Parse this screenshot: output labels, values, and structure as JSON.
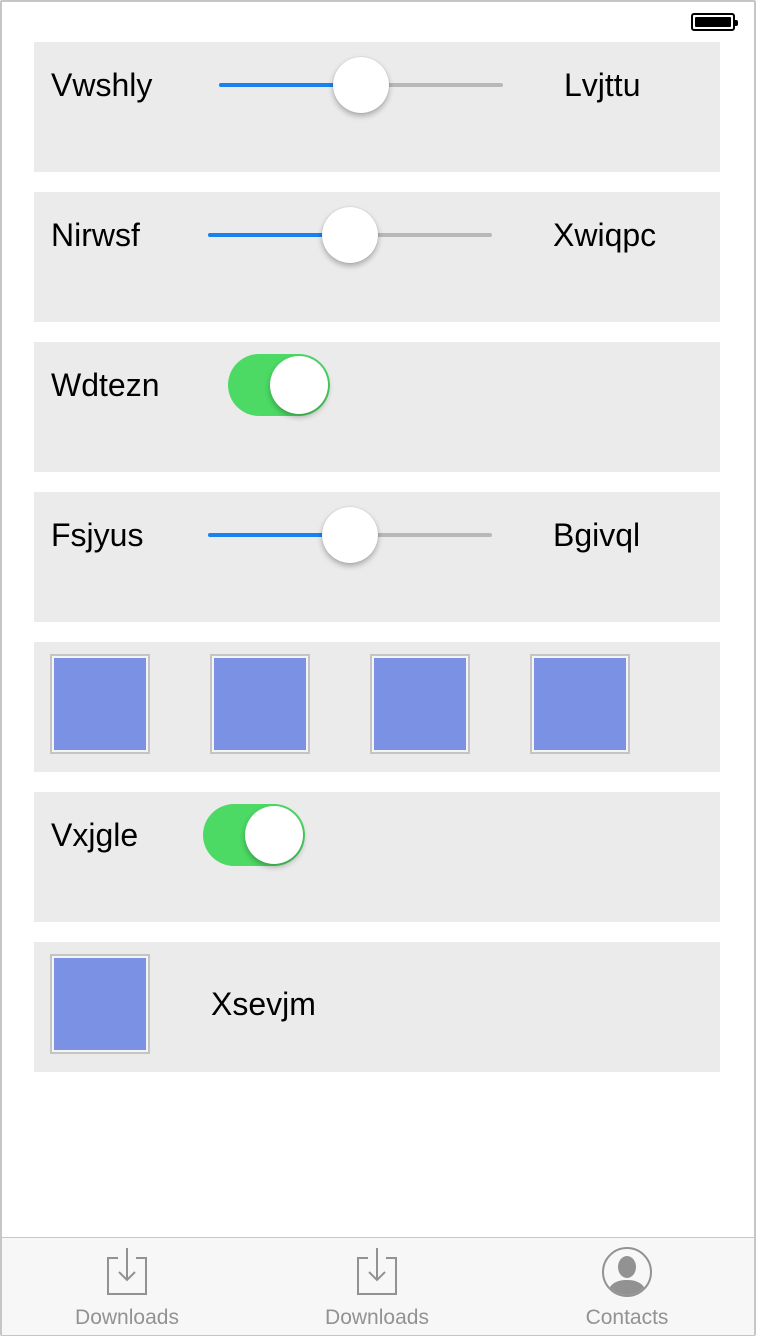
{
  "rows": [
    {
      "type": "slider",
      "left_label": "Vwshly",
      "right_label": "Lvjttu",
      "value": 0.5
    },
    {
      "type": "slider",
      "left_label": "Nirwsf",
      "right_label": "Xwiqpc",
      "value": 0.5
    },
    {
      "type": "toggle",
      "label": "Wdtezn",
      "on": true
    },
    {
      "type": "slider",
      "left_label": "Fsjyus",
      "right_label": "Bgivql",
      "value": 0.5
    },
    {
      "type": "tiles",
      "count": 4
    },
    {
      "type": "toggle",
      "label": "Vxjgle",
      "on": true
    },
    {
      "type": "tile-label",
      "label": "Xsevjm"
    }
  ],
  "colors": {
    "slider_fill": "#1a82f0",
    "toggle_on": "#4cd964",
    "tile": "#7a91e4",
    "row_bg": "#ebebeb"
  },
  "tabbar": {
    "tabs": [
      {
        "label": "Downloads",
        "icon": "download-icon"
      },
      {
        "label": "Downloads",
        "icon": "download-icon"
      },
      {
        "label": "Contacts",
        "icon": "contact-person-icon"
      }
    ]
  }
}
